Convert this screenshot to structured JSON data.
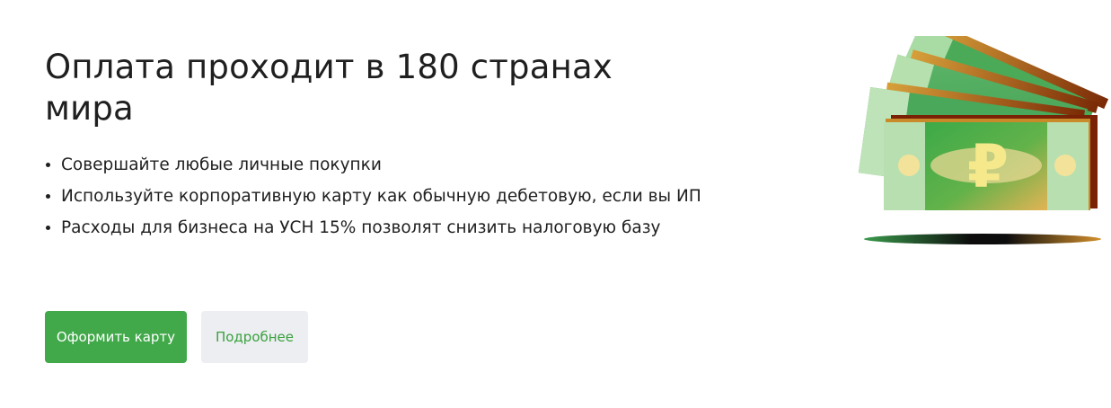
{
  "promo": {
    "title_line1": "Оплата проходит в 180 странах",
    "title_line2": "мира",
    "bullets": [
      "Совершайте любые личные покупки",
      "Используйте корпоративную карту как обычную дебетовую, если вы ИП",
      "Расходы для бизнеса на УСН 15% позволят снизить налоговую базу"
    ]
  },
  "actions": {
    "primary_label": "Оформить карту",
    "secondary_label": "Подробнее"
  },
  "illustration": {
    "currency_symbol": "₽"
  },
  "colors": {
    "accent_green": "#41a94a",
    "secondary_bg": "#eceef2",
    "secondary_text": "#3aa13d"
  }
}
